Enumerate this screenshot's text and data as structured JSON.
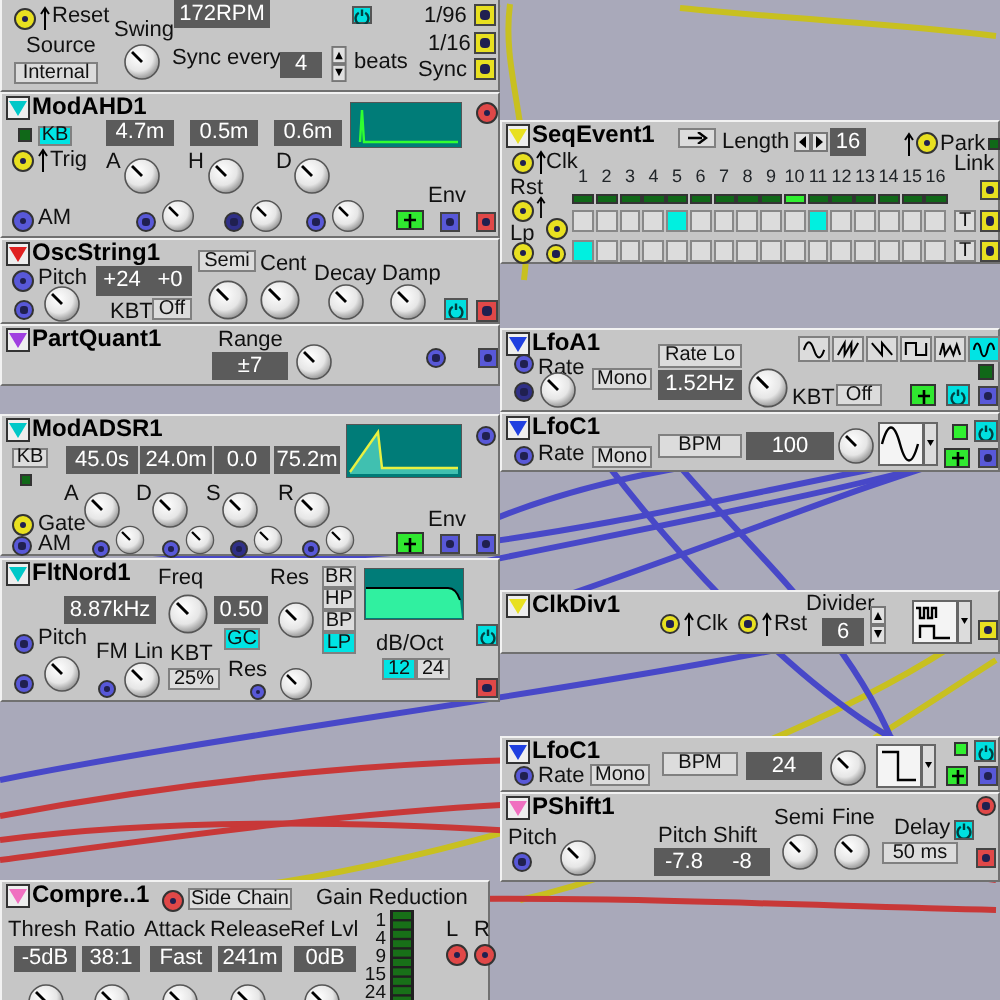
{
  "modules": [
    {
      "items": [
        {
          "kind": "jack",
          "color": "#e8e020"
        },
        {
          "kind": "trig"
        },
        {
          "kind": "label",
          "text": "Reset"
        },
        {
          "kind": "label",
          "text": "Swing"
        },
        {
          "kind": "knob"
        },
        {
          "kind": "display",
          "text": "172RPM"
        },
        {
          "kind": "power",
          "on": true
        },
        {
          "kind": "label",
          "text": "Source"
        },
        {
          "kind": "button",
          "text": "Internal",
          "selected": false
        },
        {
          "kind": "label",
          "text": "Sync every"
        },
        {
          "kind": "display",
          "text": "4"
        },
        {
          "kind": "spinner"
        },
        {
          "kind": "label",
          "text": "beats"
        },
        {
          "kind": "label",
          "text": "1/96"
        },
        {
          "kind": "label",
          "text": "1/16"
        },
        {
          "kind": "label",
          "text": "Sync"
        },
        {
          "kind": "out",
          "color": "#e8e020"
        },
        {
          "kind": "out",
          "color": "#e8e020"
        },
        {
          "kind": "out",
          "color": "#e8e020"
        }
      ]
    },
    {
      "title": "ModAHD1",
      "color": "#00c8c8",
      "items": [
        {
          "kind": "led",
          "on": false
        },
        {
          "kind": "button",
          "text": "KB",
          "selected": true
        },
        {
          "kind": "display",
          "text": "4.7m"
        },
        {
          "kind": "display",
          "text": "0.5m"
        },
        {
          "kind": "display",
          "text": "0.6m"
        },
        {
          "kind": "ahd-graph"
        },
        {
          "kind": "jack",
          "color": "#e8e020"
        },
        {
          "kind": "trig"
        },
        {
          "kind": "label",
          "text": "Trig"
        },
        {
          "kind": "label",
          "text": "A"
        },
        {
          "kind": "label",
          "text": "H"
        },
        {
          "kind": "label",
          "text": "D"
        },
        {
          "kind": "knob"
        },
        {
          "kind": "knob"
        },
        {
          "kind": "knob"
        },
        {
          "kind": "jack",
          "color": "#5858d8"
        },
        {
          "kind": "label",
          "text": "AM"
        },
        {
          "kind": "jack",
          "color": "#5858d8"
        },
        {
          "kind": "knob"
        },
        {
          "kind": "jack",
          "color": "#303088"
        },
        {
          "kind": "knob"
        },
        {
          "kind": "jack",
          "color": "#5858d8"
        },
        {
          "kind": "knob"
        },
        {
          "kind": "label",
          "text": "Env"
        },
        {
          "kind": "addbtn"
        },
        {
          "kind": "out",
          "color": "#5858d8"
        },
        {
          "kind": "out",
          "color": "#e04848"
        },
        {
          "kind": "jack",
          "color": "#e04848"
        }
      ]
    },
    {
      "title": "OscString1",
      "color": "#e02020",
      "items": [
        {
          "kind": "jack",
          "color": "#5858d8"
        },
        {
          "kind": "label",
          "text": "Pitch"
        },
        {
          "kind": "display",
          "text": "+24"
        },
        {
          "kind": "display",
          "text": "+0"
        },
        {
          "kind": "button",
          "text": "Semi",
          "selected": false
        },
        {
          "kind": "label",
          "text": "Cent"
        },
        {
          "kind": "label",
          "text": "Decay"
        },
        {
          "kind": "label",
          "text": "Damp"
        },
        {
          "kind": "knob"
        },
        {
          "kind": "knob"
        },
        {
          "kind": "knob"
        },
        {
          "kind": "knob"
        },
        {
          "kind": "knob"
        },
        {
          "kind": "jack",
          "color": "#5858d8"
        },
        {
          "kind": "label",
          "text": "KBT"
        },
        {
          "kind": "button",
          "text": "Off",
          "selected": false
        },
        {
          "kind": "power",
          "on": true
        },
        {
          "kind": "out",
          "color": "#e04848"
        }
      ]
    },
    {
      "title": "PartQuant1",
      "color": "#a040e0",
      "items": [
        {
          "kind": "label",
          "text": "Range"
        },
        {
          "kind": "display",
          "text": "±7"
        },
        {
          "kind": "knob"
        },
        {
          "kind": "jack",
          "color": "#5858d8"
        },
        {
          "kind": "out",
          "color": "#5858d8"
        }
      ]
    },
    {
      "title": "ModADSR1",
      "color": "#00c8c8",
      "items": [
        {
          "kind": "button",
          "text": "KB",
          "selected": false
        },
        {
          "kind": "led",
          "on": false
        },
        {
          "kind": "display",
          "text": "45.0s"
        },
        {
          "kind": "display",
          "text": "24.0m"
        },
        {
          "kind": "display",
          "text": "0.0"
        },
        {
          "kind": "display",
          "text": "75.2m"
        },
        {
          "kind": "adsr-graph"
        },
        {
          "kind": "label",
          "text": "A"
        },
        {
          "kind": "label",
          "text": "D"
        },
        {
          "kind": "label",
          "text": "S"
        },
        {
          "kind": "label",
          "text": "R"
        },
        {
          "kind": "knob"
        },
        {
          "kind": "knob"
        },
        {
          "kind": "knob"
        },
        {
          "kind": "knob"
        },
        {
          "kind": "jack",
          "color": "#e8e020"
        },
        {
          "kind": "label",
          "text": "Gate"
        },
        {
          "kind": "jack",
          "color": "#5858d8"
        },
        {
          "kind": "label",
          "text": "AM"
        },
        {
          "kind": "jack",
          "color": "#5858d8"
        },
        {
          "kind": "knob"
        },
        {
          "kind": "jack",
          "color": "#5858d8"
        },
        {
          "kind": "knob"
        },
        {
          "kind": "jack",
          "color": "#303088"
        },
        {
          "kind": "knob"
        },
        {
          "kind": "jack",
          "color": "#5858d8"
        },
        {
          "kind": "knob"
        },
        {
          "kind": "label",
          "text": "Env"
        },
        {
          "kind": "addbtn"
        },
        {
          "kind": "out",
          "color": "#5858d8"
        },
        {
          "kind": "out",
          "color": "#5858d8"
        },
        {
          "kind": "jack",
          "color": "#5858d8"
        }
      ]
    },
    {
      "title": "FltNord1",
      "color": "#00c8c8",
      "items": [
        {
          "kind": "label",
          "text": "Freq"
        },
        {
          "kind": "display",
          "text": "8.87kHz"
        },
        {
          "kind": "knob"
        },
        {
          "kind": "label",
          "text": "Res"
        },
        {
          "kind": "display",
          "text": "0.50"
        },
        {
          "kind": "knob"
        },
        {
          "kind": "button",
          "text": "GC",
          "selected": true
        },
        {
          "kind": "button",
          "text": "BR",
          "selected": false
        },
        {
          "kind": "button",
          "text": "HP",
          "selected": false
        },
        {
          "kind": "button",
          "text": "BP",
          "selected": false
        },
        {
          "kind": "button",
          "text": "LP",
          "selected": true
        },
        {
          "kind": "filter-graph"
        },
        {
          "kind": "label",
          "text": "dB/Oct"
        },
        {
          "kind": "button",
          "text": "12",
          "selected": true
        },
        {
          "kind": "button",
          "text": "24",
          "selected": false
        },
        {
          "kind": "jack",
          "color": "#5858d8"
        },
        {
          "kind": "label",
          "text": "Pitch"
        },
        {
          "kind": "knob"
        },
        {
          "kind": "jack",
          "color": "#5858d8"
        },
        {
          "kind": "label",
          "text": "FM Lin"
        },
        {
          "kind": "jack",
          "color": "#5858d8"
        },
        {
          "kind": "knob"
        },
        {
          "kind": "label",
          "text": "KBT"
        },
        {
          "kind": "button",
          "text": "25%",
          "selected": false
        },
        {
          "kind": "label",
          "text": "Res"
        },
        {
          "kind": "jack",
          "color": "#5858d8"
        },
        {
          "kind": "knob"
        },
        {
          "kind": "power",
          "on": true
        },
        {
          "kind": "out",
          "color": "#e04848"
        }
      ]
    },
    {
      "title": "SeqEvent1",
      "color": "#e8e020",
      "items": [
        {
          "kind": "iconbtn"
        },
        {
          "kind": "label",
          "text": "Length"
        },
        {
          "kind": "lrspinner"
        },
        {
          "kind": "display",
          "text": "16"
        },
        {
          "kind": "trig"
        },
        {
          "kind": "jack",
          "color": "#e8e020"
        },
        {
          "kind": "label",
          "text": "Park"
        },
        {
          "kind": "led",
          "on": false
        },
        {
          "kind": "jack",
          "color": "#e8e020"
        },
        {
          "kind": "trig"
        },
        {
          "kind": "label",
          "text": "Clk"
        },
        {
          "kind": "label",
          "text": "Link"
        },
        {
          "kind": "label",
          "text": "Rst"
        },
        {
          "kind": "jack",
          "color": "#e8e020"
        },
        {
          "kind": "trig"
        },
        {
          "kind": "label",
          "text": "Lp"
        },
        {
          "kind": "jack",
          "color": "#e8e020"
        },
        {
          "kind": "jack",
          "color": "#e8e020"
        },
        {
          "kind": "jack",
          "color": "#e8e020"
        },
        {
          "kind": "steps",
          "numbers": [
            "1",
            "2",
            "3",
            "4",
            "5",
            "6",
            "7",
            "8",
            "9",
            "10",
            "11",
            "12",
            "13",
            "14",
            "15",
            "16"
          ],
          "leds": [
            {
              "on": false
            },
            {
              "on": false
            },
            {
              "on": false
            },
            {
              "on": false
            },
            {
              "on": false
            },
            {
              "on": false
            },
            {
              "on": false
            },
            {
              "on": false
            },
            {
              "on": false
            },
            {
              "on": true
            },
            {
              "on": false
            },
            {
              "on": false
            },
            {
              "on": false
            },
            {
              "on": false
            },
            {
              "on": false
            },
            {
              "on": false
            }
          ],
          "rows": [
            {
              "cells": [
                {
                  "selected": false
                },
                {
                  "selected": false
                },
                {
                  "selected": false
                },
                {
                  "selected": false
                },
                {
                  "selected": true
                },
                {
                  "selected": false
                },
                {
                  "selected": false
                },
                {
                  "selected": false
                },
                {
                  "selected": false
                },
                {
                  "selected": false
                },
                {
                  "selected": true
                },
                {
                  "selected": false
                },
                {
                  "selected": false
                },
                {
                  "selected": false
                },
                {
                  "selected": false
                },
                {
                  "selected": false
                }
              ]
            },
            {
              "cells": [
                {
                  "selected": true
                },
                {
                  "selected": false
                },
                {
                  "selected": false
                },
                {
                  "selected": false
                },
                {
                  "selected": false
                },
                {
                  "selected": false
                },
                {
                  "selected": false
                },
                {
                  "selected": false
                },
                {
                  "selected": false
                },
                {
                  "selected": false
                },
                {
                  "selected": false
                },
                {
                  "selected": false
                },
                {
                  "selected": false
                },
                {
                  "selected": false
                },
                {
                  "selected": false
                },
                {
                  "selected": false
                }
              ]
            }
          ]
        },
        {
          "kind": "button",
          "text": "T",
          "selected": false
        },
        {
          "kind": "button",
          "text": "T",
          "selected": false
        },
        {
          "kind": "out",
          "color": "#e8e020"
        },
        {
          "kind": "out",
          "color": "#e8e020"
        },
        {
          "kind": "out",
          "color": "#e8e020"
        }
      ]
    },
    {
      "title": "LfoA1",
      "color": "#2040e0",
      "items": [
        {
          "kind": "jack",
          "color": "#5858d8"
        },
        {
          "kind": "label",
          "text": "Rate"
        },
        {
          "kind": "jack",
          "color": "#303088"
        },
        {
          "kind": "knob"
        },
        {
          "kind": "button",
          "text": "Rate Lo",
          "selected": false
        },
        {
          "kind": "wavebtn",
          "selected": false
        },
        {
          "kind": "wavebtn",
          "selected": false
        },
        {
          "kind": "wavebtn",
          "selected": false
        },
        {
          "kind": "wavebtn",
          "selected": false
        },
        {
          "kind": "wavebtn",
          "selected": false
        },
        {
          "kind": "wavebtn",
          "selected": true
        },
        {
          "kind": "button",
          "text": "Mono",
          "selected": false
        },
        {
          "kind": "display",
          "text": "1.52Hz"
        },
        {
          "kind": "knob"
        },
        {
          "kind": "label",
          "text": "KBT"
        },
        {
          "kind": "button",
          "text": "Off",
          "selected": false
        },
        {
          "kind": "led",
          "on": false
        },
        {
          "kind": "addbtn"
        },
        {
          "kind": "power",
          "on": true
        },
        {
          "kind": "out",
          "color": "#5858d8"
        }
      ]
    },
    {
      "title": "LfoC1",
      "color": "#2040e0",
      "items": [
        {
          "kind": "jack",
          "color": "#5858d8"
        },
        {
          "kind": "label",
          "text": "Rate"
        },
        {
          "kind": "button",
          "text": "Mono",
          "selected": false
        },
        {
          "kind": "button",
          "text": "BPM",
          "selected": false
        },
        {
          "kind": "display",
          "text": "100"
        },
        {
          "kind": "knob"
        },
        {
          "kind": "sine-select"
        },
        {
          "kind": "led",
          "on": true
        },
        {
          "kind": "power",
          "on": true
        },
        {
          "kind": "addbtn"
        },
        {
          "kind": "out",
          "color": "#5858d8"
        }
      ]
    },
    {
      "title": "ClkDiv1",
      "color": "#e8e020",
      "items": [
        {
          "kind": "jack",
          "color": "#e8e020"
        },
        {
          "kind": "trig"
        },
        {
          "kind": "label",
          "text": "Clk"
        },
        {
          "kind": "jack",
          "color": "#e8e020"
        },
        {
          "kind": "trig"
        },
        {
          "kind": "label",
          "text": "Rst"
        },
        {
          "kind": "label",
          "text": "Divider"
        },
        {
          "kind": "display",
          "text": "6"
        },
        {
          "kind": "spinner"
        },
        {
          "kind": "clock-select"
        },
        {
          "kind": "out",
          "color": "#e8e020"
        }
      ]
    },
    {
      "title": "LfoC1",
      "color": "#2040e0",
      "items": [
        {
          "kind": "jack",
          "color": "#5858d8"
        },
        {
          "kind": "label",
          "text": "Rate"
        },
        {
          "kind": "button",
          "text": "Mono",
          "selected": false
        },
        {
          "kind": "button",
          "text": "BPM",
          "selected": false
        },
        {
          "kind": "display",
          "text": "24"
        },
        {
          "kind": "knob"
        },
        {
          "kind": "square-select"
        },
        {
          "kind": "led",
          "on": true
        },
        {
          "kind": "power",
          "on": true
        },
        {
          "kind": "addbtn"
        },
        {
          "kind": "out",
          "color": "#5858d8"
        }
      ]
    },
    {
      "title": "PShift1",
      "color": "#f070c0",
      "items": [
        {
          "kind": "label",
          "text": "Pitch"
        },
        {
          "kind": "jack",
          "color": "#5858d8"
        },
        {
          "kind": "knob"
        },
        {
          "kind": "label",
          "text": "Pitch Shift"
        },
        {
          "kind": "display",
          "text": "-7.8"
        },
        {
          "kind": "display",
          "text": "-8"
        },
        {
          "kind": "label",
          "text": "Semi"
        },
        {
          "kind": "knob"
        },
        {
          "kind": "label",
          "text": "Fine"
        },
        {
          "kind": "knob"
        },
        {
          "kind": "label",
          "text": "Delay"
        },
        {
          "kind": "button",
          "text": "50 ms",
          "selected": false
        },
        {
          "kind": "power",
          "on": true
        },
        {
          "kind": "out",
          "color": "#e04848"
        },
        {
          "kind": "jack",
          "color": "#e04848"
        }
      ]
    },
    {
      "title": "Compre..1",
      "color": "#f070c0",
      "items": [
        {
          "kind": "jack",
          "color": "#e04848"
        },
        {
          "kind": "button",
          "text": "Side Chain",
          "selected": false
        },
        {
          "kind": "label",
          "text": "Gain Reduction"
        },
        {
          "kind": "label",
          "text": "Thresh"
        },
        {
          "kind": "label",
          "text": "Ratio"
        },
        {
          "kind": "label",
          "text": "Attack"
        },
        {
          "kind": "label",
          "text": "Release"
        },
        {
          "kind": "label",
          "text": "Ref Lvl"
        },
        {
          "kind": "display",
          "text": "-5dB"
        },
        {
          "kind": "display",
          "text": "38:1"
        },
        {
          "kind": "display",
          "text": "Fast"
        },
        {
          "kind": "display",
          "text": "241m"
        },
        {
          "kind": "display",
          "text": "0dB"
        },
        {
          "kind": "knob"
        },
        {
          "kind": "knob"
        },
        {
          "kind": "knob"
        },
        {
          "kind": "knob"
        },
        {
          "kind": "knob"
        },
        {
          "kind": "scale",
          "text": "1"
        },
        {
          "kind": "scale",
          "text": "4"
        },
        {
          "kind": "scale",
          "text": "9"
        },
        {
          "kind": "scale",
          "text": "15"
        },
        {
          "kind": "scale",
          "text": "24"
        },
        {
          "kind": "meter"
        },
        {
          "kind": "label",
          "text": "L"
        },
        {
          "kind": "label",
          "text": "R"
        },
        {
          "kind": "jack",
          "color": "#e04848"
        },
        {
          "kind": "jack",
          "color": "#e04848"
        }
      ]
    }
  ]
}
